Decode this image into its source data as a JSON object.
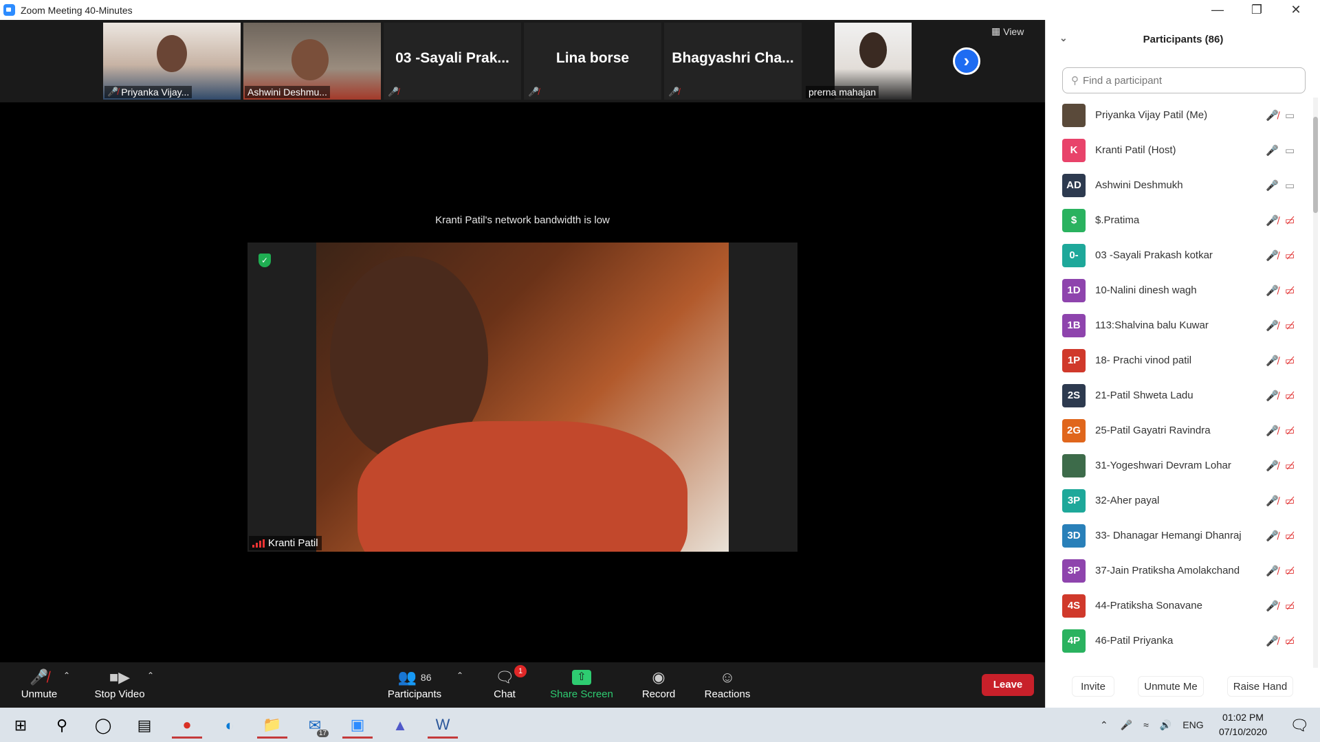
{
  "window": {
    "title": "Zoom Meeting 40-Minutes"
  },
  "gallery": {
    "tiles": [
      {
        "label": "Priyanka Vijay...",
        "muted": true
      },
      {
        "label": "Ashwini Deshmu...",
        "muted": false
      },
      {
        "name": "03 -Sayali  Prak...",
        "muted": true
      },
      {
        "name": "Lina borse",
        "muted": true
      },
      {
        "name": "Bhagyashri  Cha...",
        "muted": true
      },
      {
        "label": "prerna mahajan",
        "muted": false
      }
    ],
    "view_label": "View"
  },
  "main": {
    "bandwidth_note": "Kranti Patil's network bandwidth is low",
    "speaker_label": "Kranti Patil"
  },
  "toolbar": {
    "unmute": "Unmute",
    "stop_video": "Stop Video",
    "participants": "Participants",
    "participants_count": "86",
    "chat": "Chat",
    "chat_badge": "1",
    "share_screen": "Share Screen",
    "record": "Record",
    "reactions": "Reactions",
    "leave": "Leave"
  },
  "panel": {
    "title": "Participants (86)",
    "search_placeholder": "Find a participant",
    "participants": [
      {
        "initials": "",
        "name": "Priyanka Vijay Patil (Me)",
        "color": "#5a4a3a",
        "mic": "muted",
        "cam": "on"
      },
      {
        "initials": "K",
        "name": "Kranti Patil (Host)",
        "color": "#e8436a",
        "mic": "on",
        "cam": "on"
      },
      {
        "initials": "AD",
        "name": "Ashwini Deshmukh",
        "color": "#2d3a4f",
        "mic": "on",
        "cam": "on"
      },
      {
        "initials": "$",
        "name": "$.Pratima",
        "color": "#2ab25f",
        "mic": "muted",
        "cam": "off"
      },
      {
        "initials": "0-",
        "name": "03 -Sayali  Prakash kotkar",
        "color": "#1ea89a",
        "mic": "muted",
        "cam": "off"
      },
      {
        "initials": "1D",
        "name": "10-Nalini dinesh wagh",
        "color": "#8e44ad",
        "mic": "muted",
        "cam": "off"
      },
      {
        "initials": "1B",
        "name": "113:Shalvina balu Kuwar",
        "color": "#8e44ad",
        "mic": "muted",
        "cam": "off"
      },
      {
        "initials": "1P",
        "name": "18- Prachi vinod patil",
        "color": "#d0392b",
        "mic": "muted",
        "cam": "off"
      },
      {
        "initials": "2S",
        "name": "21-Patil Shweta Ladu",
        "color": "#2d3a4f",
        "mic": "muted",
        "cam": "off"
      },
      {
        "initials": "2G",
        "name": "25-Patil Gayatri Ravindra",
        "color": "#e0661c",
        "mic": "muted",
        "cam": "off"
      },
      {
        "initials": "",
        "name": "31-Yogeshwari Devram Lohar",
        "color": "#3d6b4a",
        "mic": "muted",
        "cam": "off"
      },
      {
        "initials": "3P",
        "name": "32-Aher payal",
        "color": "#1ea89a",
        "mic": "muted",
        "cam": "off"
      },
      {
        "initials": "3D",
        "name": "33- Dhanagar Hemangi Dhanraj",
        "color": "#2980b9",
        "mic": "muted",
        "cam": "off"
      },
      {
        "initials": "3P",
        "name": "37-Jain Pratiksha Amolakchand",
        "color": "#8e44ad",
        "mic": "muted",
        "cam": "off"
      },
      {
        "initials": "4S",
        "name": "44-Pratiksha Sonavane",
        "color": "#d0392b",
        "mic": "muted",
        "cam": "off"
      },
      {
        "initials": "4P",
        "name": "46-Patil Priyanka",
        "color": "#2ab25f",
        "mic": "muted",
        "cam": "off"
      }
    ],
    "invite": "Invite",
    "unmute_me": "Unmute Me",
    "raise_hand": "Raise Hand"
  },
  "taskbar": {
    "mail_badge": "17",
    "language": "ENG",
    "time": "01:02 PM",
    "date": "07/10/2020"
  }
}
